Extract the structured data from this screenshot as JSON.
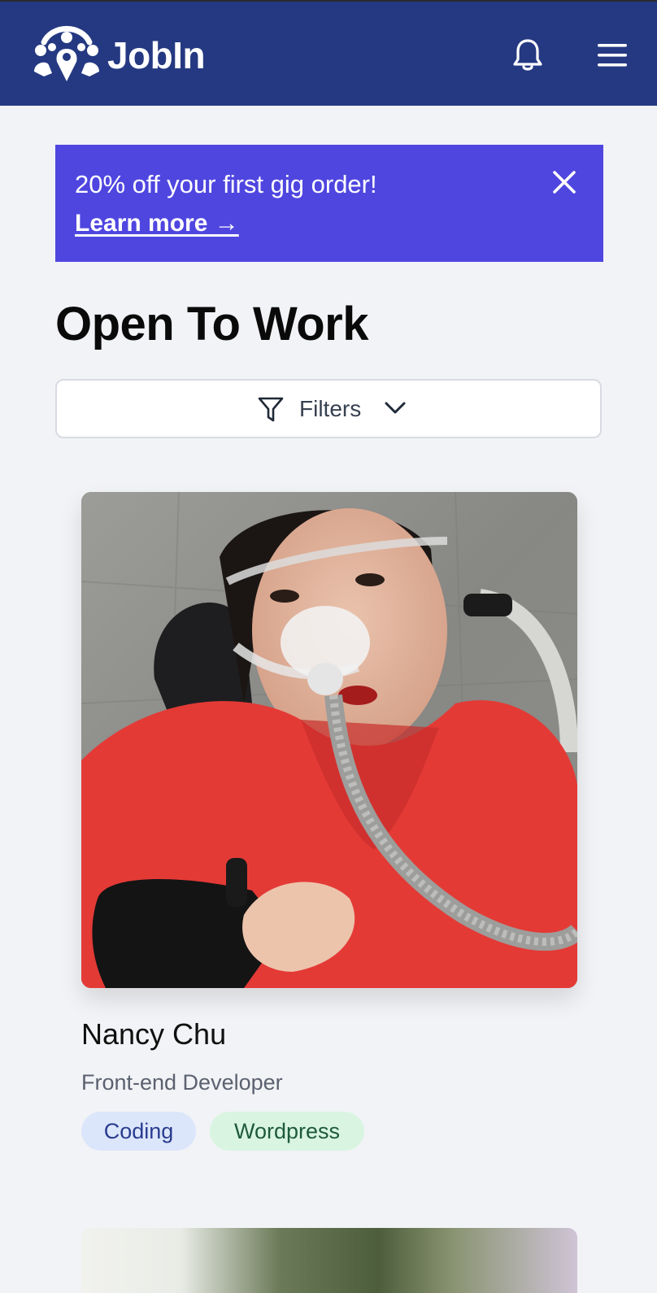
{
  "header": {
    "brand": "JobIn",
    "logo_icon": "people-pin-logo-icon",
    "bell_icon": "bell-icon",
    "menu_icon": "hamburger-menu-icon",
    "bg_color": "#253982"
  },
  "promo": {
    "text": "20% off your first gig order!",
    "link": "Learn more →",
    "close_icon": "close-icon",
    "bg_color": "#4f46e0"
  },
  "page": {
    "title": "Open To Work"
  },
  "filters": {
    "label": "Filters",
    "icon": "funnel-icon",
    "chevron": "chevron-down-icon"
  },
  "profiles": [
    {
      "name": "Nancy Chu",
      "role": "Front-end Developer",
      "tags": [
        "Coding",
        "Wordpress"
      ]
    }
  ]
}
